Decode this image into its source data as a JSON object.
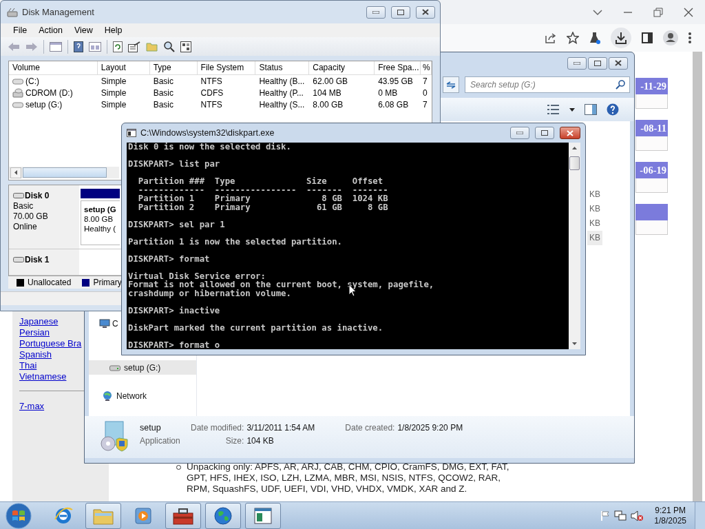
{
  "browser": {
    "sidebar_links": [
      "Japanese",
      "Persian",
      "Portuguese Bra",
      "Spanish",
      "Thai",
      "Vietnamese"
    ],
    "sidebar_footer_link": "7-max",
    "date_cards": [
      {
        "date": "-11-29"
      },
      {
        "date": "-08-11"
      },
      {
        "date": "-06-19"
      }
    ],
    "sub_bullet": "Unpacking only: APFS, AR, ARJ, CAB, CHM, CPIO, CramFS, DMG, EXT, FAT, GPT, HFS, IHEX, ISO, LZH, LZMA, MBR, MSI, NSIS, NTFS, QCOW2, RAR, RPM, SquashFS, UDF, UEFI, VDI, VHD, VHDX, VMDK, XAR and Z."
  },
  "explorer": {
    "search": {
      "placeholder": "Search setup (G:)"
    },
    "nav_items": [
      {
        "label": "C",
        "kind": "computer",
        "selected": false
      },
      {
        "label": "setup (G:)",
        "kind": "drive",
        "selected": true
      },
      {
        "label": "Network",
        "kind": "network",
        "selected": false
      }
    ],
    "sizes": [
      "KB",
      "KB",
      "KB",
      "KB"
    ],
    "details": {
      "name": "setup",
      "type": "Application",
      "column_1": [
        {
          "label": "Date modified:",
          "value": "3/11/2011 1:54 AM"
        },
        {
          "label": "Size:",
          "value": "104 KB"
        }
      ],
      "column_2": [
        {
          "label": "Date created:",
          "value": "1/8/2025 9:20 PM"
        }
      ]
    }
  },
  "disk_management": {
    "title": "Disk Management",
    "menu": [
      "File",
      "Action",
      "View",
      "Help"
    ],
    "columns": [
      "Volume",
      "Layout",
      "Type",
      "File System",
      "Status",
      "Capacity",
      "Free Spa...",
      "%"
    ],
    "rows": [
      {
        "kind": "hdd",
        "cells": [
          "(C:)",
          "Simple",
          "Basic",
          "NTFS",
          "Healthy (B...",
          "62.00 GB",
          "43.95 GB",
          "7"
        ]
      },
      {
        "kind": "cdrom",
        "cells": [
          "CDROM (D:)",
          "Simple",
          "Basic",
          "CDFS",
          "Healthy (P...",
          "104 MB",
          "0 MB",
          "0"
        ]
      },
      {
        "kind": "hdd",
        "cells": [
          "setup (G:)",
          "Simple",
          "Basic",
          "NTFS",
          "Healthy (S...",
          "8.00 GB",
          "6.08 GB",
          "7"
        ]
      }
    ],
    "disks": [
      {
        "name": "Disk 0",
        "lines": [
          "Basic",
          "70.00 GB",
          "Online"
        ]
      },
      {
        "name": "Disk 1"
      }
    ],
    "partition": {
      "title": "setup (G",
      "lines": [
        "8.00 GB",
        "Healthy ("
      ]
    },
    "legend": [
      {
        "label": "Unallocated",
        "color": "#000000"
      },
      {
        "label": "Primary",
        "color": "#000080"
      }
    ]
  },
  "console": {
    "title": "C:\\Windows\\system32\\diskpart.exe",
    "blocks": [
      [
        "Disk 0 is now the selected disk."
      ],
      [
        "DISKPART> list par"
      ],
      [
        "  Partition ###  Type              Size     Offset",
        "  -------------  ----------------  -------  -------",
        "  Partition 1    Primary              8 GB  1024 KB",
        "  Partition 2    Primary             61 GB     8 GB"
      ],
      [
        "DISKPART> sel par 1"
      ],
      [
        "Partition 1 is now the selected partition."
      ],
      [
        "DISKPART> format"
      ],
      [
        "Virtual Disk Service error:",
        "Format is not allowed on the current boot, system, pagefile,",
        "crashdump or hibernation volume."
      ],
      [
        "DISKPART> inactive"
      ],
      [
        "DiskPart marked the current partition as inactive."
      ],
      [
        "DISKPART> format o"
      ]
    ]
  },
  "taskbar": {
    "apps": [
      {
        "kind": "ie",
        "running": false
      },
      {
        "kind": "explorer",
        "running": true
      },
      {
        "kind": "media",
        "running": false
      },
      {
        "kind": "toolbox",
        "running": true
      },
      {
        "kind": "globe",
        "running": true
      },
      {
        "kind": "app",
        "running": true
      }
    ],
    "time": "9:21 PM",
    "date": "1/8/2025"
  }
}
